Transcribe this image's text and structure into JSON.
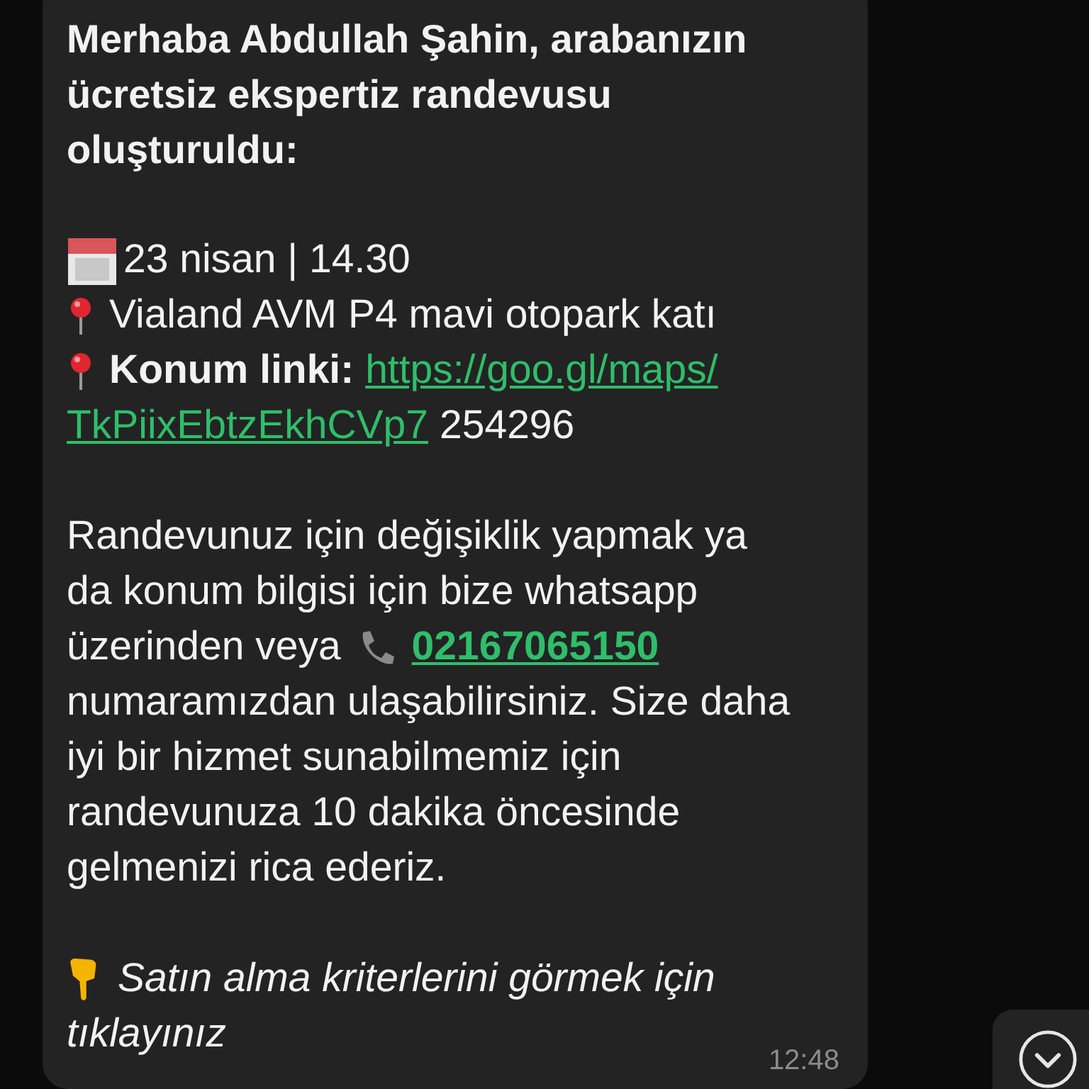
{
  "message": {
    "greeting_lines": [
      "Merhaba Abdullah Şahin, arabanızın",
      "ücretsiz ekspertiz randevusu",
      "oluşturuldu:"
    ],
    "date_line": "23 nisan | 14.30",
    "location_line": "Vialand AVM P4 mavi otopark katı",
    "link_label": "Konum linki:",
    "link_lines": [
      "https://goo.gl/maps/",
      "TkPiixEbtzEkhCVp7"
    ],
    "link_suffix": "254296",
    "info_lines_before_phone": [
      "Randevunuz için değişiklik yapmak ya",
      "da konum bilgisi için bize whatsapp",
      "üzerinden veya"
    ],
    "phone": "02167065150",
    "info_lines_after_phone": [
      "numaramızdan ulaşabilirsiniz. Size daha",
      "iyi bir hizmet sunabilmemiz için",
      "randevunuza 10 dakika öncesinde",
      "gelmenizi rica ederiz."
    ],
    "call_to_action_lines": [
      "Satın alma kriterlerini görmek için",
      "tıklayınız"
    ],
    "time": "12:48"
  }
}
